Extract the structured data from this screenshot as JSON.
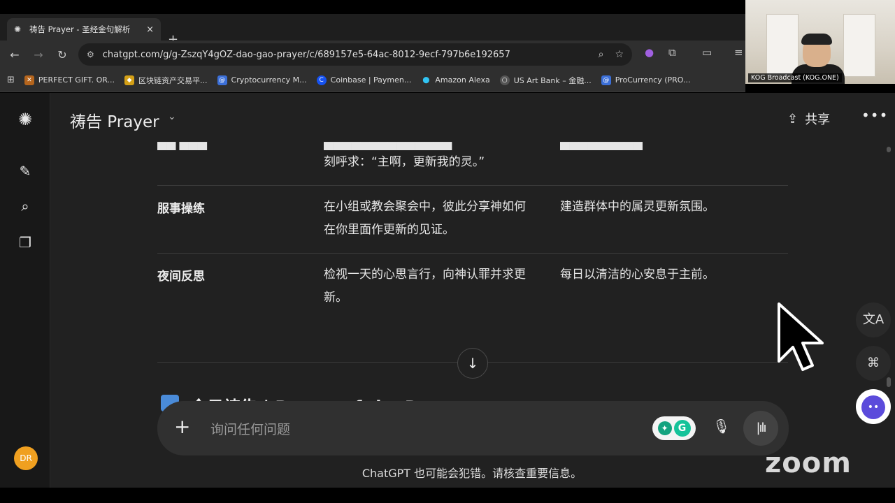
{
  "browser": {
    "tab_title": "祷告 Prayer - 圣经金句解析",
    "tab_close": "×",
    "new_tab": "+",
    "url": "chatgpt.com/g/g-ZszqY4gOZ-dao-gao-prayer/c/689157e5-64ac-8012-9ecf-797b6e192657",
    "bookmarks": [
      {
        "label": "PERFECT GIFT. OR...",
        "color": "#b5651d"
      },
      {
        "label": "区块链资产交易平...",
        "color": "#d4a017"
      },
      {
        "label": "Cryptocurrency M...",
        "color": "#3b6fd8"
      },
      {
        "label": "Coinbase | Paymen...",
        "color": "#1652f0"
      },
      {
        "label": "Amazon Alexa",
        "color": "#31c4f3"
      },
      {
        "label": "US Art Bank – 金融...",
        "color": "#555555"
      },
      {
        "label": "ProCurrency (PRO...",
        "color": "#3b6fd8"
      }
    ]
  },
  "webcam": {
    "label": "KOG Broadcast (KOG.ONE)"
  },
  "app": {
    "header_title": "祷告 Prayer",
    "share_label": "共享",
    "avatar_initials": "DR",
    "table_rows": [
      {
        "col1": "服事操练",
        "col2": "在小组或教会聚会中，彼此分享神如何在你里面作更新的见证。",
        "col3": "建造群体中的属灵更新氛围。"
      },
      {
        "col1": "夜间反思",
        "col2": "检视一天的心思言行，向神认罪并求更新。",
        "col3": "每日以清洁的心安息于主前。"
      }
    ],
    "partial_prev_row_col2": "刻呼求：“主啊，更新我的灵。”",
    "next_section_heading": "今日祷告 | Prayer of the Day",
    "composer_placeholder": "询问任何问题",
    "disclaimer": "ChatGPT 也可能会犯错。请核查重要信息。"
  },
  "overlay": {
    "zoom_logo": "zoom"
  },
  "colors": {
    "app_bg": "#212121",
    "rail_bg": "#181818",
    "avatar": "#f0a020",
    "composer_bg": "#303030"
  }
}
